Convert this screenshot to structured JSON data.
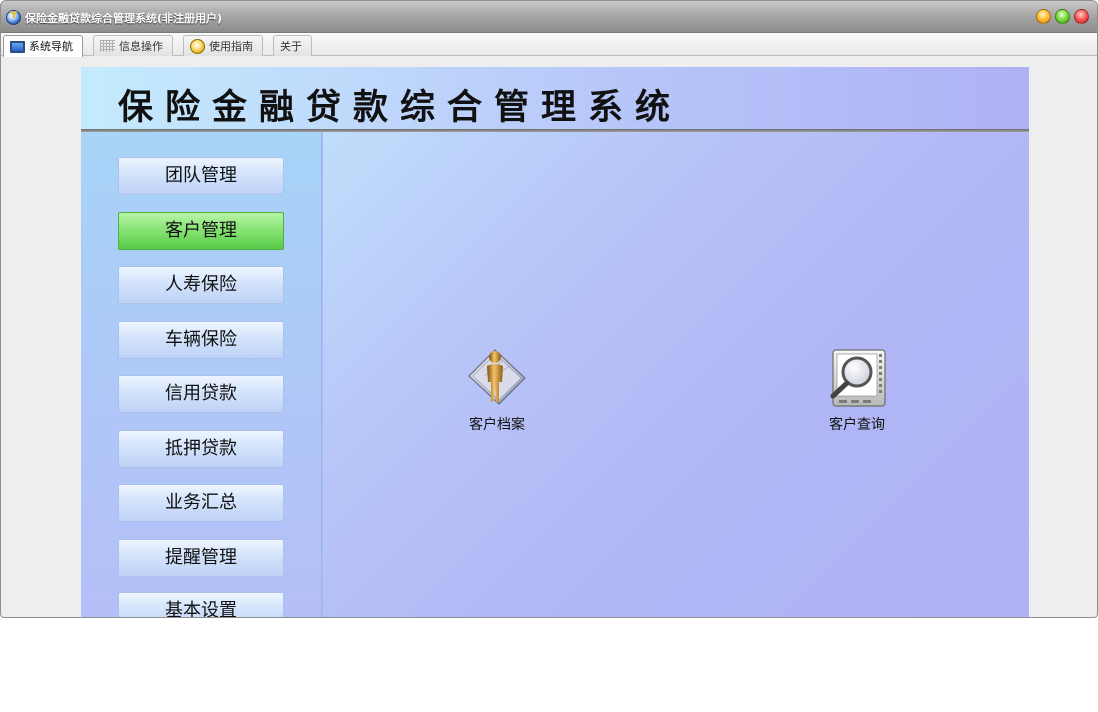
{
  "window": {
    "title": "保险金融贷款综合管理系统(非注册用户)"
  },
  "tabs": [
    {
      "label": "系统导航",
      "icon": "monitor-icon",
      "active": true
    },
    {
      "label": "信息操作",
      "icon": "grid-icon",
      "active": false
    },
    {
      "label": "使用指南",
      "icon": "guide-icon",
      "active": false
    },
    {
      "label": "关于",
      "icon": "",
      "active": false
    }
  ],
  "banner": {
    "title": "保险金融贷款综合管理系统"
  },
  "sidebar": {
    "items": [
      {
        "label": "团队管理",
        "active": false
      },
      {
        "label": "客户管理",
        "active": true
      },
      {
        "label": "人寿保险",
        "active": false
      },
      {
        "label": "车辆保险",
        "active": false
      },
      {
        "label": "信用贷款",
        "active": false
      },
      {
        "label": "抵押贷款",
        "active": false
      },
      {
        "label": "业务汇总",
        "active": false
      },
      {
        "label": "提醒管理",
        "active": false
      },
      {
        "label": "基本设置",
        "active": false
      }
    ]
  },
  "content": {
    "features": [
      {
        "label": "客户档案",
        "icon": "customer-profile-icon"
      },
      {
        "label": "客户查询",
        "icon": "customer-search-icon"
      }
    ]
  },
  "colors": {
    "panel_bg": "#b0b7f4",
    "active_nav": "#7fe06b",
    "nav_btn": "#d3e3fb"
  }
}
